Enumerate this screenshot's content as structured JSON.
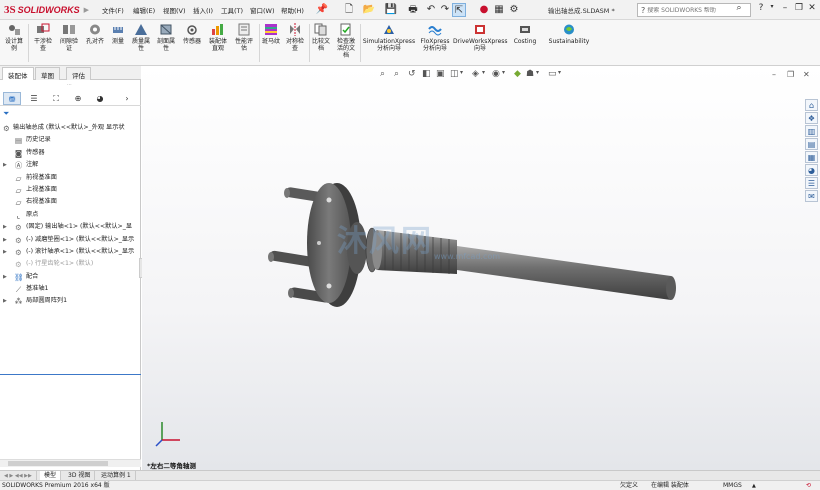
{
  "app": {
    "logo_ds": "3S",
    "logo_text": "SOLIDWORKS",
    "doc_title": "输出轴总成.SLDASM *"
  },
  "menu": [
    "文件(F)",
    "编辑(E)",
    "视图(V)",
    "插入(I)",
    "工具(T)",
    "窗口(W)",
    "帮助(H)"
  ],
  "search": {
    "placeholder": "搜索 SOLIDWORKS 帮助"
  },
  "toolbar": [
    {
      "label": "设计算\n例",
      "icon": "design-study-icon"
    },
    {
      "label": "干涉检\n查",
      "icon": "interference-check-icon"
    },
    {
      "label": "间隙验\n证",
      "icon": "clearance-verify-icon"
    },
    {
      "label": "孔对齐",
      "icon": "hole-align-icon"
    },
    {
      "label": "测量",
      "icon": "measure-icon"
    },
    {
      "label": "质量属\n性",
      "icon": "mass-properties-icon"
    },
    {
      "label": "剖面属\n性",
      "icon": "section-properties-icon"
    },
    {
      "label": "传感器",
      "icon": "sensor-icon"
    },
    {
      "label": "装配体\n直观",
      "icon": "assembly-visualization-icon"
    },
    {
      "label": "性能评\n估",
      "icon": "performance-evaluation-icon"
    },
    {
      "label": "斑马纹",
      "icon": "zebra-stripes-icon"
    },
    {
      "label": "对称检\n查",
      "icon": "symmetry-check-icon"
    },
    {
      "label": "比较文\n档",
      "icon": "compare-documents-icon"
    },
    {
      "label": "检查激\n活的文\n档",
      "icon": "check-active-document-icon"
    },
    {
      "label": "SimulationXpress\n分析向导",
      "icon": "simulationxpress-icon"
    },
    {
      "label": "FloXpress\n分析向导",
      "icon": "floxpress-icon"
    },
    {
      "label": "DriveWorksXpress\n向导",
      "icon": "driveworksxpress-icon"
    },
    {
      "label": "Costing",
      "icon": "costing-icon"
    },
    {
      "label": "Sustainability",
      "icon": "sustainability-icon"
    }
  ],
  "tabs": [
    "装配体",
    "草图",
    "评估"
  ],
  "tree": [
    {
      "label": "输出轴总成 (默认<<默认>_外观 显示状",
      "icon": "assembly-icon",
      "level": 0,
      "expand": false,
      "dim": false
    },
    {
      "label": "历史记录",
      "icon": "history-icon",
      "level": 1,
      "expand": false,
      "dim": false
    },
    {
      "label": "传感器",
      "icon": "sensor-icon",
      "level": 1,
      "expand": false,
      "dim": false
    },
    {
      "label": "注解",
      "icon": "annotation-icon",
      "level": 1,
      "expand": true,
      "dim": false
    },
    {
      "label": "前视基准面",
      "icon": "plane-icon",
      "level": 1,
      "expand": false,
      "dim": false
    },
    {
      "label": "上视基准面",
      "icon": "plane-icon",
      "level": 1,
      "expand": false,
      "dim": false
    },
    {
      "label": "右视基准面",
      "icon": "plane-icon",
      "level": 1,
      "expand": false,
      "dim": false
    },
    {
      "label": "原点",
      "icon": "origin-icon",
      "level": 1,
      "expand": false,
      "dim": false
    },
    {
      "label": "(固定) 输出轴<1> (默认<<默认>_显",
      "icon": "part-icon",
      "level": 1,
      "expand": true,
      "dim": false
    },
    {
      "label": "(-) 减磨垫圈<1> (默认<<默认>_显示",
      "icon": "part-icon",
      "level": 1,
      "expand": true,
      "dim": false
    },
    {
      "label": "(-) 滚针轴承<1> (默认<<默认>_显示",
      "icon": "part-icon",
      "level": 1,
      "expand": true,
      "dim": false
    },
    {
      "label": "(-) 行星齿轮<1> (默认)",
      "icon": "part-icon",
      "level": 1,
      "expand": false,
      "dim": true
    },
    {
      "label": "配合",
      "icon": "mates-icon",
      "level": 1,
      "expand": true,
      "dim": false
    },
    {
      "label": "基准轴1",
      "icon": "axis-icon",
      "level": 1,
      "expand": false,
      "dim": false
    },
    {
      "label": "局部圆周阵列1",
      "icon": "pattern-icon",
      "level": 1,
      "expand": true,
      "dim": false
    }
  ],
  "viewport": {
    "watermark": "沐风网",
    "watermark_url": "www.mfcad.com",
    "view_label": "*左右二等角轴测"
  },
  "bottom_tabs": [
    "模型",
    "3D 视图",
    "运动算例 1"
  ],
  "status": {
    "product": "SOLIDWORKS Premium 2016 x64 版",
    "underdefined": "欠定义",
    "editing": "在编辑 装配体",
    "units": "MMGS"
  },
  "colors": {
    "brand": "#c8102e",
    "selection": "#3c78c8"
  }
}
